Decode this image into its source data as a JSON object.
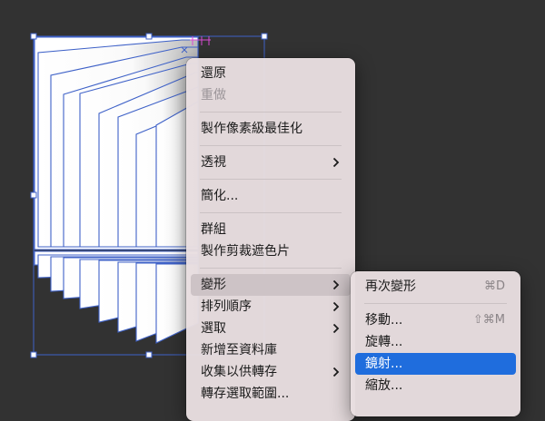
{
  "colors": {
    "canvas_bg": "#323232",
    "selection_blue": "#3f62c8",
    "menu_bg": "#e8dee0",
    "highlight_blue": "#1f6ddd",
    "submenu_parent_hover": "#cdc3c6"
  },
  "context_menu": {
    "items": [
      {
        "label": "還原",
        "enabled": true
      },
      {
        "label": "重做",
        "enabled": false
      },
      {
        "separator": true
      },
      {
        "label": "製作像素級最佳化",
        "enabled": true
      },
      {
        "separator": true
      },
      {
        "label": "透視",
        "enabled": true,
        "submenu": true
      },
      {
        "separator": true
      },
      {
        "label": "簡化...",
        "enabled": true
      },
      {
        "separator": true
      },
      {
        "label": "群組",
        "enabled": true
      },
      {
        "label": "製作剪裁遮色片",
        "enabled": true
      },
      {
        "separator": true
      },
      {
        "label": "變形",
        "enabled": true,
        "submenu": true,
        "open": true
      },
      {
        "label": "排列順序",
        "enabled": true,
        "submenu": true
      },
      {
        "label": "選取",
        "enabled": true,
        "submenu": true
      },
      {
        "label": "新增至資料庫",
        "enabled": true
      },
      {
        "label": "收集以供轉存",
        "enabled": true,
        "submenu": true
      },
      {
        "label": "轉存選取範圍...",
        "enabled": true
      }
    ]
  },
  "transform_submenu": {
    "items": [
      {
        "label": "再次變形",
        "shortcut": "⌘D"
      },
      {
        "separator": true
      },
      {
        "label": "移動...",
        "shortcut": "⇧⌘M"
      },
      {
        "label": "旋轉...",
        "shortcut": ""
      },
      {
        "label": "鏡射...",
        "shortcut": "",
        "highlighted": true
      },
      {
        "label": "縮放...",
        "shortcut": ""
      }
    ]
  }
}
